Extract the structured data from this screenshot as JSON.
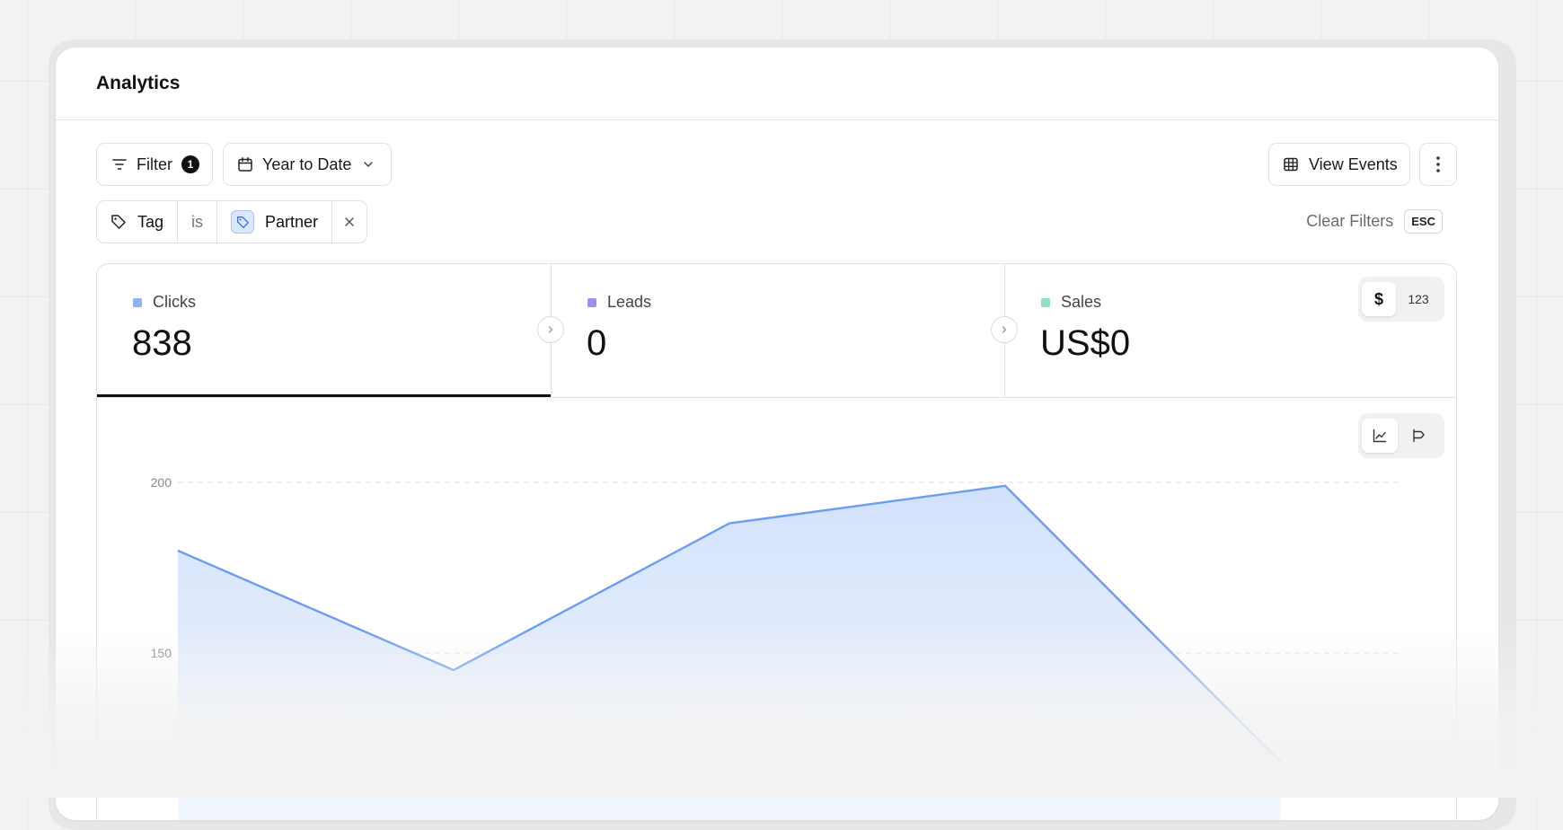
{
  "header": {
    "title": "Analytics"
  },
  "toolbar": {
    "filter_label": "Filter",
    "filter_count": "1",
    "date_range_label": "Year to Date",
    "view_events_label": "View Events"
  },
  "active_filter": {
    "field": "Tag",
    "operator": "is",
    "value": "Partner"
  },
  "clear_filters": {
    "label": "Clear Filters",
    "shortcut": "ESC"
  },
  "metrics": [
    {
      "label": "Clicks",
      "value": "838",
      "color": "#8fb1f5"
    },
    {
      "label": "Leads",
      "value": "0",
      "color": "#a78bf5"
    },
    {
      "label": "Sales",
      "value": "US$0",
      "color": "#8ee0c8"
    }
  ],
  "unit_toggle": {
    "currency_label": "$",
    "count_label": "123"
  },
  "colors": {
    "accent": "#6b9df0",
    "fill": "#dbe6fc"
  },
  "chart_data": {
    "type": "area",
    "x": [
      0,
      1,
      2,
      3,
      4
    ],
    "values": [
      180,
      145,
      188,
      199,
      118
    ],
    "yticks": [
      150,
      200
    ],
    "ylim": [
      120,
      210
    ],
    "grid": true
  }
}
